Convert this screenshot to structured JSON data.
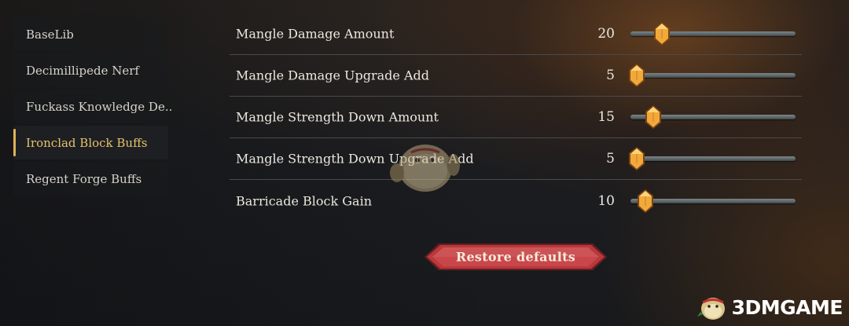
{
  "sidebar": {
    "items": [
      {
        "label": "BaseLib",
        "active": false
      },
      {
        "label": "Decimillipede Nerf",
        "active": false
      },
      {
        "label": "Fuckass Knowledge De..",
        "active": false
      },
      {
        "label": "Ironclad Block Buffs",
        "active": true
      },
      {
        "label": "Regent Forge Buffs",
        "active": false
      }
    ]
  },
  "settings": {
    "rows": [
      {
        "label": "Mangle Damage Amount",
        "value": "20",
        "fill": 0.19
      },
      {
        "label": "Mangle Damage Upgrade Add",
        "value": "5",
        "fill": 0.04
      },
      {
        "label": "Mangle Strength Down Amount",
        "value": "15",
        "fill": 0.14
      },
      {
        "label": "Mangle Strength Down Upgrade Add",
        "value": "5",
        "fill": 0.04
      },
      {
        "label": "Barricade Block Gain",
        "value": "10",
        "fill": 0.09
      }
    ]
  },
  "restore_button": {
    "label": "Restore defaults"
  },
  "watermark": {
    "text": "3DMGAME"
  },
  "colors": {
    "accent": "#e0b257",
    "active_text": "#e6c36a",
    "knob": "#f2a93b",
    "button": "#b8383b"
  }
}
